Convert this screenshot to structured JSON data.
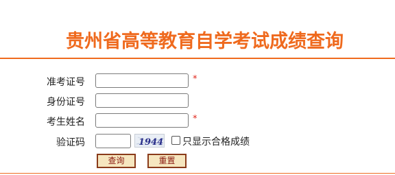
{
  "page": {
    "title": "贵州省高等教育自学考试成绩查询"
  },
  "form": {
    "admission_label": "准考证号",
    "id_label": "身份证号",
    "name_label": "考生姓名",
    "captcha_label": "验证码",
    "required_mark": "*",
    "captcha_text": "1944",
    "only_pass_label": "只显示合格成绩",
    "only_pass_checked": false,
    "admission_value": "",
    "id_value": "",
    "name_value": "",
    "captcha_value": ""
  },
  "buttons": {
    "query": "查询",
    "reset": "重置"
  },
  "colors": {
    "accent": "#ef6a1e",
    "required": "#e0261b",
    "button_bg": "#f6e6bf",
    "button_border": "#8a3a1a",
    "button_text": "#8a1a12"
  }
}
